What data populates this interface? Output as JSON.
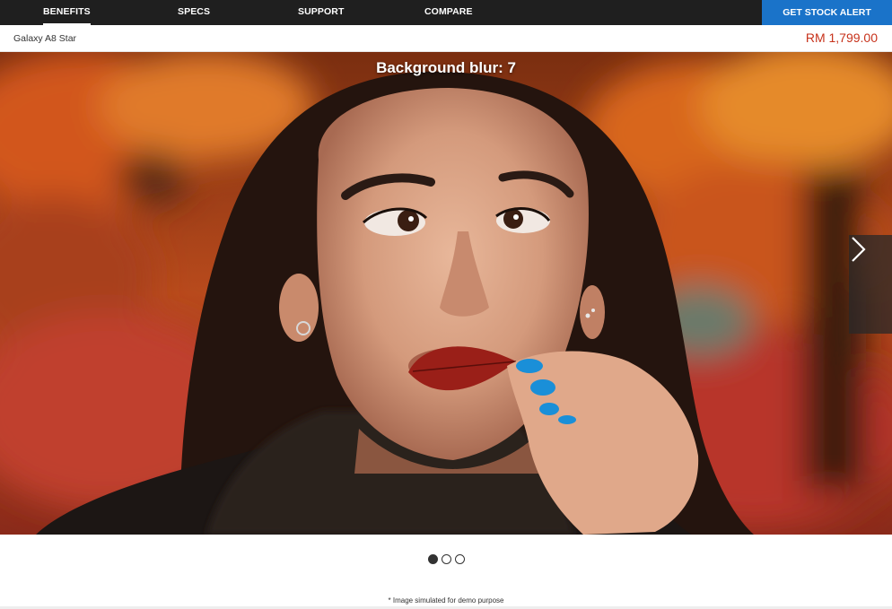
{
  "nav": {
    "items": [
      {
        "label": "BENEFITS",
        "active": true
      },
      {
        "label": "SPECS",
        "active": false
      },
      {
        "label": "SUPPORT",
        "active": false
      },
      {
        "label": "COMPARE",
        "active": false
      }
    ],
    "cta_label": "GET STOCK ALERT"
  },
  "product": {
    "name": "Galaxy A8 Star",
    "price": "RM 1,799.00"
  },
  "hero": {
    "caption": "Background blur: 7",
    "next_icon": "chevron-right-icon"
  },
  "carousel": {
    "count": 3,
    "active_index": 0
  },
  "disclaimer": "* Image simulated for demo purpose",
  "colors": {
    "nav_bg": "#1f1f1f",
    "cta_bg": "#1a73c9",
    "price": "#c7321b"
  }
}
